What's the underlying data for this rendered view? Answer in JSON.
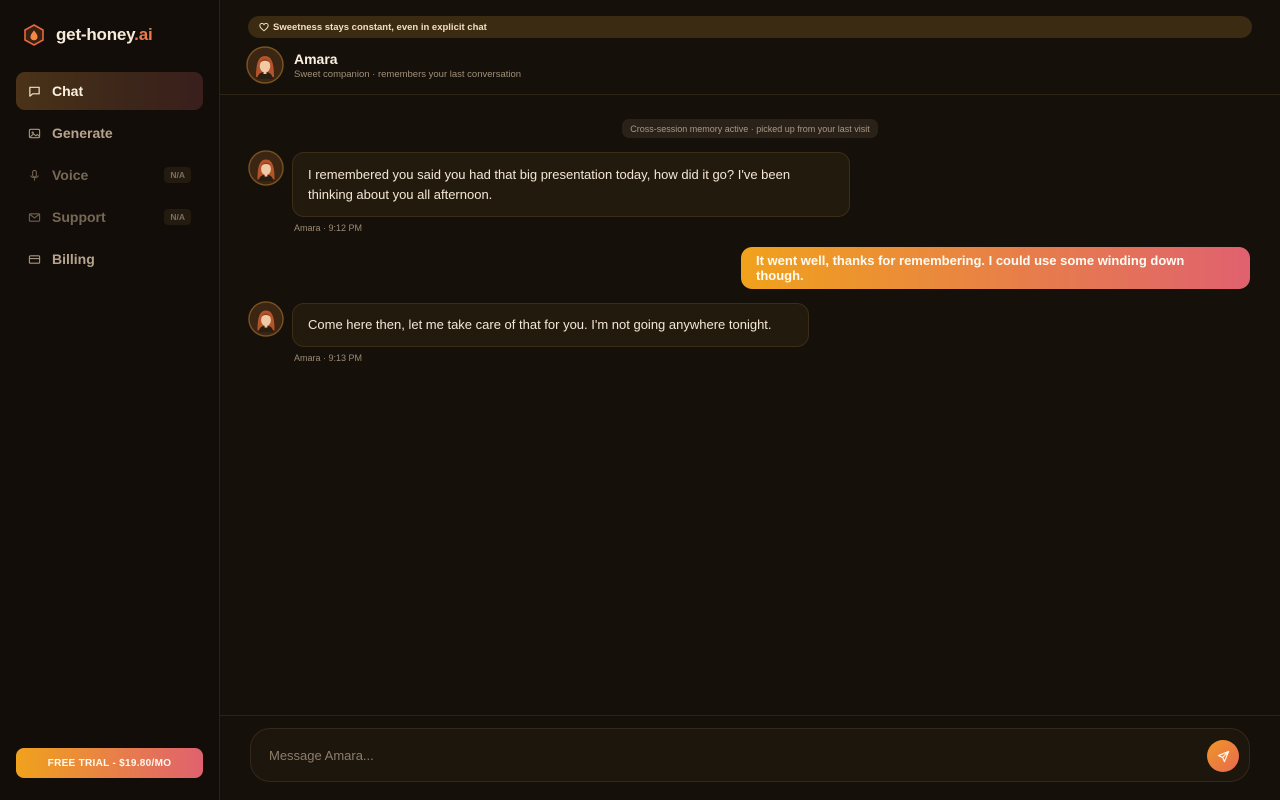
{
  "brand": {
    "name": "get-honey",
    "tld": ".ai"
  },
  "nav": [
    {
      "label": "Chat",
      "icon": "chat-icon",
      "state": "active"
    },
    {
      "label": "Generate",
      "icon": "image-icon",
      "state": "normal"
    },
    {
      "label": "Voice",
      "icon": "microphone-icon",
      "state": "disabled",
      "badge": "N/A"
    },
    {
      "label": "Support",
      "icon": "mail-icon",
      "state": "disabled",
      "badge": "N/A"
    },
    {
      "label": "Billing",
      "icon": "credit-card-icon",
      "state": "normal"
    }
  ],
  "trial_button": "FREE TRIAL - $19.80/MO",
  "banner": "Sweetness stays constant, even in explicit chat",
  "companion": {
    "name": "Amara",
    "subtitle": "Sweet companion · remembers your last conversation"
  },
  "memory_notice": "Cross-session memory active · picked up from your last visit",
  "messages": [
    {
      "from": "companion",
      "text": "I remembered you said you had that big presentation today, how did it go? I've been thinking about you all afternoon.",
      "meta": "Amara · 9:12 PM"
    },
    {
      "from": "user",
      "text": "It went well, thanks for remembering. I could use some winding down though."
    },
    {
      "from": "companion",
      "text": "Come here then, let me take care of that for you. I'm not going anywhere tonight.",
      "meta": "Amara · 9:13 PM"
    }
  ],
  "composer": {
    "placeholder": "Message Amara...",
    "value": ""
  },
  "colors": {
    "accent_start": "#f0a21c",
    "accent_end": "#e0616f",
    "background": "#15100a",
    "sidebar": "#120d08"
  }
}
